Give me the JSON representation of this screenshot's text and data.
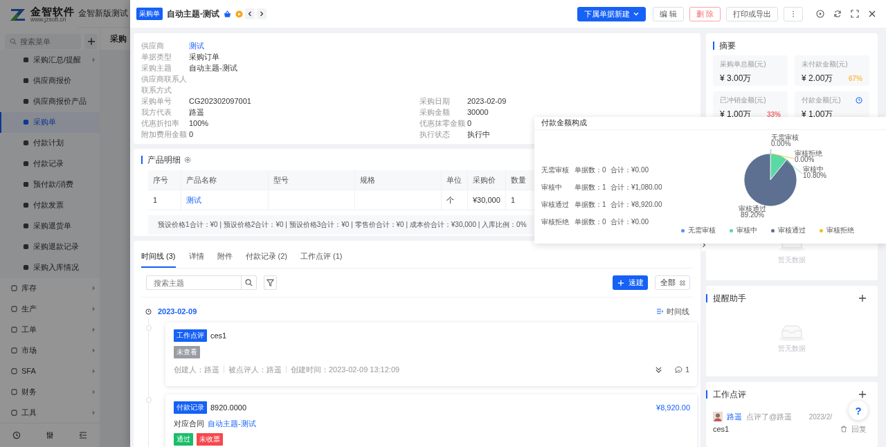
{
  "app": {
    "logo_title": "金智软件",
    "logo_site": "www.jzsoft.cn",
    "title": "金智新版测试"
  },
  "sidebar": {
    "search_placeholder": "搜索菜单",
    "sub_items": [
      {
        "label": "采购汇总/提醒",
        "selected": false,
        "has_children": true
      },
      {
        "label": "供应商报价",
        "selected": false,
        "has_children": false
      },
      {
        "label": "供应商报价产品",
        "selected": false,
        "has_children": false
      },
      {
        "label": "采购单",
        "selected": true,
        "has_children": false
      },
      {
        "label": "付款计划",
        "selected": false,
        "has_children": false
      },
      {
        "label": "付款记录",
        "selected": false,
        "has_children": false
      },
      {
        "label": "预付款/消费",
        "selected": false,
        "has_children": false
      },
      {
        "label": "付款发票",
        "selected": false,
        "has_children": false
      },
      {
        "label": "采购退货单",
        "selected": false,
        "has_children": false
      },
      {
        "label": "采购退款记录",
        "selected": false,
        "has_children": false
      },
      {
        "label": "采购入库情况",
        "selected": false,
        "has_children": false
      }
    ],
    "groups": [
      {
        "label": "库存"
      },
      {
        "label": "生产"
      },
      {
        "label": "工单"
      },
      {
        "label": "市场"
      },
      {
        "label": "SFA"
      },
      {
        "label": "财务"
      },
      {
        "label": "工具"
      }
    ]
  },
  "background": {
    "tab": "采购"
  },
  "header": {
    "tag": "采购单",
    "title": "自动主题-测试",
    "actions": [
      {
        "label": "下属单据新建",
        "kind": "primary"
      },
      {
        "label": "编 辑",
        "kind": "default"
      },
      {
        "label": "删 除",
        "kind": "danger"
      },
      {
        "label": "打印或导出",
        "kind": "default"
      }
    ]
  },
  "info": {
    "left": [
      {
        "label": "供应商",
        "value": "测试",
        "link": true
      },
      {
        "label": "单据类型",
        "value": "采购订单",
        "link": false
      },
      {
        "label": "采购主题",
        "value": "自动主题-测试",
        "link": false
      },
      {
        "label": "供应商联系人"
      },
      {
        "label": "联系方式"
      },
      {
        "label": "采购单号",
        "value": "CG202302097001",
        "link": false
      },
      {
        "label": "我方代表",
        "value": "路遥",
        "link": false
      },
      {
        "label": "优惠折扣率",
        "value": "100%",
        "link": false
      },
      {
        "label": "附加费用金额",
        "value": "0",
        "link": false
      }
    ],
    "right": [
      {
        "label": "采购日期",
        "value": "2023-02-09"
      },
      {
        "label": "采购金额",
        "value": "30000"
      },
      {
        "label": "优惠抹零金额",
        "value": "0"
      },
      {
        "label": "执行状态",
        "value": "执行中"
      }
    ]
  },
  "products": {
    "title": "产品明细",
    "columns": [
      "序号",
      "产品名称",
      "型号",
      "规格",
      "单位",
      "采购价",
      "数量"
    ],
    "rows": [
      {
        "number": "1",
        "product_name": "测试",
        "unit": "个",
        "price": "¥30,000",
        "quantity": "1"
      }
    ],
    "summary": "预设价格1合计：¥0 | 预设价格2合计：¥0 | 预设价格3合计：¥0 | 零售价合计：¥0 | 成本价合计：¥30,000 | 入库比例：0%"
  },
  "timeline": {
    "tabs": [
      {
        "label": "时间线 (3)",
        "selected": true
      },
      {
        "label": "详情",
        "selected": false
      },
      {
        "label": "附件",
        "selected": false
      },
      {
        "label": "付款记录 (2)",
        "selected": false
      },
      {
        "label": "工作点评 (1)",
        "selected": false
      }
    ],
    "search_placeholder": "搜索主题",
    "quick_button": "速建",
    "all_button": "全部",
    "date": "2023-02-09",
    "view_label": "时间线",
    "entries": [
      {
        "kind": "review",
        "tag": "工作点评",
        "title": "ces1",
        "statuses": [
          {
            "label": "未查看",
            "color": "#9a9ca3"
          }
        ],
        "meta": [
          "创建人：路遥",
          "被点评人：路遥",
          "创建时间：2023-02-09 13:12:09"
        ],
        "comments": "1"
      },
      {
        "kind": "payment",
        "tag": "付款记录",
        "title": "8920.0000",
        "amount": "¥8,920.00",
        "contract_label": "对应合同",
        "contract": "自动主题-测试",
        "statuses": [
          {
            "label": "通过",
            "color": "#19be6b"
          },
          {
            "label": "未收票",
            "color": "#f5484d"
          }
        ]
      }
    ]
  },
  "summary": {
    "title": "摘要",
    "stats": [
      {
        "kind": "plain",
        "label": "采购单总额(元)",
        "value": "¥ 3.00万"
      },
      {
        "kind": "percent",
        "label": "未付款金额(元)",
        "value": "¥ 2.00万",
        "percent": "67%",
        "color": "#fbbf57"
      },
      {
        "kind": "percent",
        "label": "已冲销金额(元)",
        "value": "¥ 1.00万",
        "percent": "33%",
        "color": "#f56c6c"
      },
      {
        "kind": "history",
        "label": "付款金额(元)",
        "value": "¥ 1.00万"
      }
    ]
  },
  "empty_card": {
    "text": "暂无数据"
  },
  "reminders": {
    "title": "提醒助手",
    "empty": "暂无数据"
  },
  "reviews": {
    "title": "工作点评",
    "items": [
      {
        "author": "路遥",
        "action": "点评了@路遥",
        "date": "2023/2/",
        "text": "ces1",
        "reply": "回复"
      }
    ]
  },
  "help": "?",
  "popover": {
    "title": "付款金额构成",
    "rows": [
      {
        "name": "无需审核",
        "count": "单据数：0",
        "total": "合计：¥0.00"
      },
      {
        "name": "审核中",
        "count": "单据数：1",
        "total": "合计：¥1,080.00"
      },
      {
        "name": "审核通过",
        "count": "单据数：1",
        "total": "合计：¥8,920.00"
      },
      {
        "name": "审核拒绝",
        "count": "单据数：0",
        "total": "合计：¥0.00"
      }
    ],
    "legend": [
      {
        "label": "无需审核",
        "color": "#5b8ff9"
      },
      {
        "label": "审核中",
        "color": "#5ad8a6"
      },
      {
        "label": "审核通过",
        "color": "#5d7092"
      },
      {
        "label": "审核拒绝",
        "color": "#f6bd16"
      }
    ],
    "chart_data": {
      "type": "pie",
      "categories": [
        "无需审核",
        "审核中",
        "审核通过",
        "审核拒绝"
      ],
      "values": [
        0,
        10.8,
        89.2,
        0
      ],
      "value_labels": [
        "0.00%",
        "10.80%",
        "89.20%",
        "0.00%"
      ]
    }
  }
}
